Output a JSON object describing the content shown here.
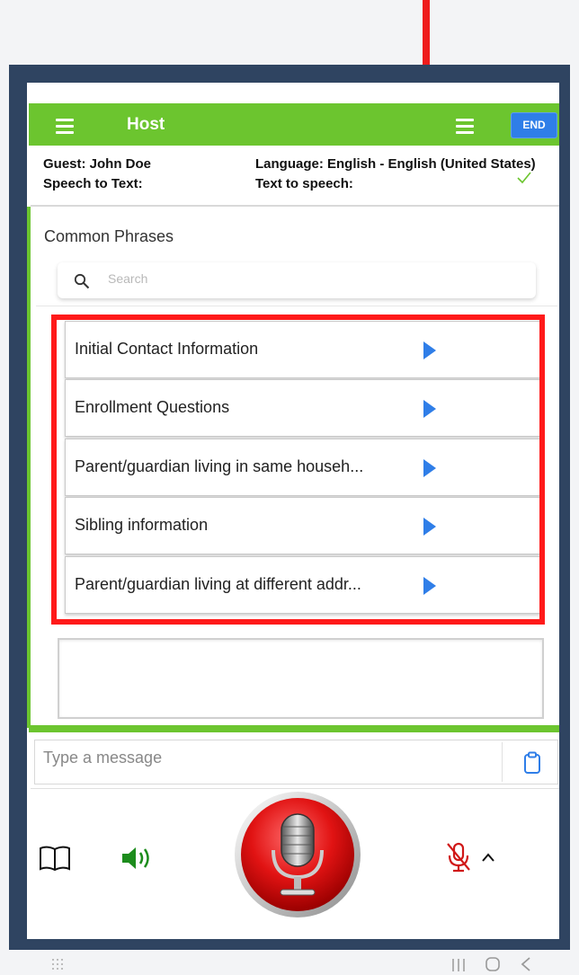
{
  "header": {
    "title": "Host",
    "end_label": "END"
  },
  "info": {
    "guest": "Guest: John Doe",
    "language": "Language: English - English (United States)",
    "speech_to_text": "Speech to Text:",
    "text_to_speech": "Text to speech:"
  },
  "phrases": {
    "heading": "Common Phrases",
    "search_placeholder": "Search",
    "items": [
      {
        "label": "Initial Contact Information"
      },
      {
        "label": "Enrollment Questions"
      },
      {
        "label": "Parent/guardian living in same househ..."
      },
      {
        "label": "Sibling information"
      },
      {
        "label": "Parent/guardian living at different addr..."
      }
    ]
  },
  "message": {
    "placeholder": "Type a message"
  },
  "colors": {
    "header_green": "#6cc52f",
    "accent_blue": "#2f7ee8",
    "annotation_red": "#ee1c1c",
    "frame_navy": "#2f4461"
  },
  "icons": {
    "menu": "menu-icon",
    "search": "search-icon",
    "play": "play-icon",
    "clipboard": "clipboard-icon",
    "book": "book-icon",
    "speaker": "speaker-icon",
    "microphone": "microphone-icon",
    "mic_muted": "mic-muted-icon",
    "caret": "chevron-up-icon"
  }
}
